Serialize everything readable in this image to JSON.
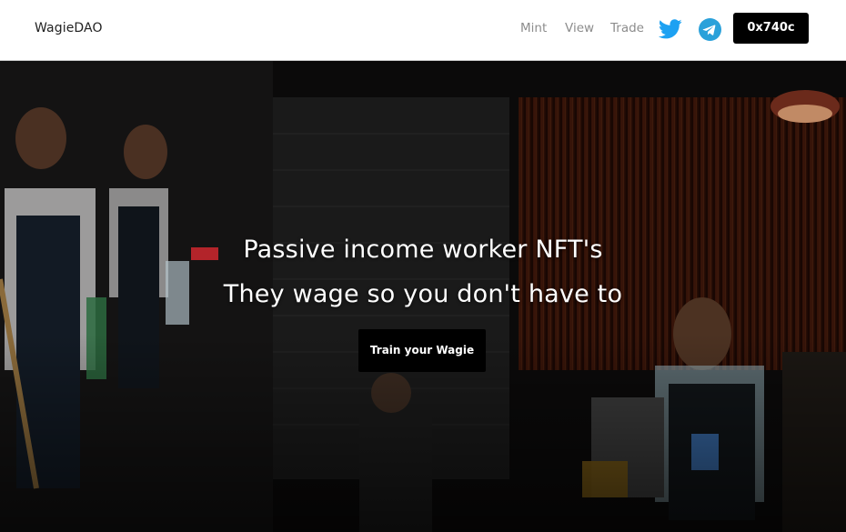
{
  "header": {
    "brand": "WagieDAO",
    "nav": {
      "mint": "Mint",
      "view": "View",
      "trade": "Trade"
    },
    "icons": {
      "twitter": "twitter-icon",
      "telegram": "telegram-icon"
    },
    "wallet_label": "0x740c"
  },
  "hero": {
    "line1": "Passive income worker NFT's",
    "line2": "They wage so you don't have to",
    "cta_label": "Train your Wagie"
  },
  "colors": {
    "twitter": "#1da1f2",
    "telegram": "#2aa1da",
    "nav_text": "#8c8c8c",
    "button_bg": "#000000"
  }
}
